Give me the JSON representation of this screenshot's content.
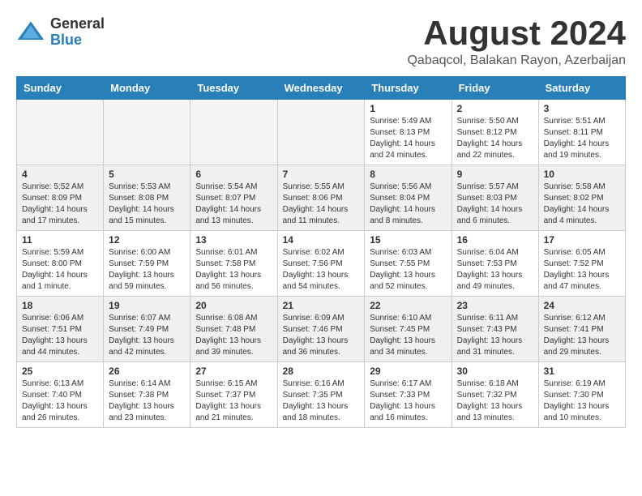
{
  "header": {
    "logo_general": "General",
    "logo_blue": "Blue",
    "month_year": "August 2024",
    "location": "Qabaqcol, Balakan Rayon, Azerbaijan"
  },
  "weekdays": [
    "Sunday",
    "Monday",
    "Tuesday",
    "Wednesday",
    "Thursday",
    "Friday",
    "Saturday"
  ],
  "weeks": [
    [
      {
        "day": "",
        "info": ""
      },
      {
        "day": "",
        "info": ""
      },
      {
        "day": "",
        "info": ""
      },
      {
        "day": "",
        "info": ""
      },
      {
        "day": "1",
        "info": "Sunrise: 5:49 AM\nSunset: 8:13 PM\nDaylight: 14 hours\nand 24 minutes."
      },
      {
        "day": "2",
        "info": "Sunrise: 5:50 AM\nSunset: 8:12 PM\nDaylight: 14 hours\nand 22 minutes."
      },
      {
        "day": "3",
        "info": "Sunrise: 5:51 AM\nSunset: 8:11 PM\nDaylight: 14 hours\nand 19 minutes."
      }
    ],
    [
      {
        "day": "4",
        "info": "Sunrise: 5:52 AM\nSunset: 8:09 PM\nDaylight: 14 hours\nand 17 minutes."
      },
      {
        "day": "5",
        "info": "Sunrise: 5:53 AM\nSunset: 8:08 PM\nDaylight: 14 hours\nand 15 minutes."
      },
      {
        "day": "6",
        "info": "Sunrise: 5:54 AM\nSunset: 8:07 PM\nDaylight: 14 hours\nand 13 minutes."
      },
      {
        "day": "7",
        "info": "Sunrise: 5:55 AM\nSunset: 8:06 PM\nDaylight: 14 hours\nand 11 minutes."
      },
      {
        "day": "8",
        "info": "Sunrise: 5:56 AM\nSunset: 8:04 PM\nDaylight: 14 hours\nand 8 minutes."
      },
      {
        "day": "9",
        "info": "Sunrise: 5:57 AM\nSunset: 8:03 PM\nDaylight: 14 hours\nand 6 minutes."
      },
      {
        "day": "10",
        "info": "Sunrise: 5:58 AM\nSunset: 8:02 PM\nDaylight: 14 hours\nand 4 minutes."
      }
    ],
    [
      {
        "day": "11",
        "info": "Sunrise: 5:59 AM\nSunset: 8:00 PM\nDaylight: 14 hours\nand 1 minute."
      },
      {
        "day": "12",
        "info": "Sunrise: 6:00 AM\nSunset: 7:59 PM\nDaylight: 13 hours\nand 59 minutes."
      },
      {
        "day": "13",
        "info": "Sunrise: 6:01 AM\nSunset: 7:58 PM\nDaylight: 13 hours\nand 56 minutes."
      },
      {
        "day": "14",
        "info": "Sunrise: 6:02 AM\nSunset: 7:56 PM\nDaylight: 13 hours\nand 54 minutes."
      },
      {
        "day": "15",
        "info": "Sunrise: 6:03 AM\nSunset: 7:55 PM\nDaylight: 13 hours\nand 52 minutes."
      },
      {
        "day": "16",
        "info": "Sunrise: 6:04 AM\nSunset: 7:53 PM\nDaylight: 13 hours\nand 49 minutes."
      },
      {
        "day": "17",
        "info": "Sunrise: 6:05 AM\nSunset: 7:52 PM\nDaylight: 13 hours\nand 47 minutes."
      }
    ],
    [
      {
        "day": "18",
        "info": "Sunrise: 6:06 AM\nSunset: 7:51 PM\nDaylight: 13 hours\nand 44 minutes."
      },
      {
        "day": "19",
        "info": "Sunrise: 6:07 AM\nSunset: 7:49 PM\nDaylight: 13 hours\nand 42 minutes."
      },
      {
        "day": "20",
        "info": "Sunrise: 6:08 AM\nSunset: 7:48 PM\nDaylight: 13 hours\nand 39 minutes."
      },
      {
        "day": "21",
        "info": "Sunrise: 6:09 AM\nSunset: 7:46 PM\nDaylight: 13 hours\nand 36 minutes."
      },
      {
        "day": "22",
        "info": "Sunrise: 6:10 AM\nSunset: 7:45 PM\nDaylight: 13 hours\nand 34 minutes."
      },
      {
        "day": "23",
        "info": "Sunrise: 6:11 AM\nSunset: 7:43 PM\nDaylight: 13 hours\nand 31 minutes."
      },
      {
        "day": "24",
        "info": "Sunrise: 6:12 AM\nSunset: 7:41 PM\nDaylight: 13 hours\nand 29 minutes."
      }
    ],
    [
      {
        "day": "25",
        "info": "Sunrise: 6:13 AM\nSunset: 7:40 PM\nDaylight: 13 hours\nand 26 minutes."
      },
      {
        "day": "26",
        "info": "Sunrise: 6:14 AM\nSunset: 7:38 PM\nDaylight: 13 hours\nand 23 minutes."
      },
      {
        "day": "27",
        "info": "Sunrise: 6:15 AM\nSunset: 7:37 PM\nDaylight: 13 hours\nand 21 minutes."
      },
      {
        "day": "28",
        "info": "Sunrise: 6:16 AM\nSunset: 7:35 PM\nDaylight: 13 hours\nand 18 minutes."
      },
      {
        "day": "29",
        "info": "Sunrise: 6:17 AM\nSunset: 7:33 PM\nDaylight: 13 hours\nand 16 minutes."
      },
      {
        "day": "30",
        "info": "Sunrise: 6:18 AM\nSunset: 7:32 PM\nDaylight: 13 hours\nand 13 minutes."
      },
      {
        "day": "31",
        "info": "Sunrise: 6:19 AM\nSunset: 7:30 PM\nDaylight: 13 hours\nand 10 minutes."
      }
    ]
  ]
}
